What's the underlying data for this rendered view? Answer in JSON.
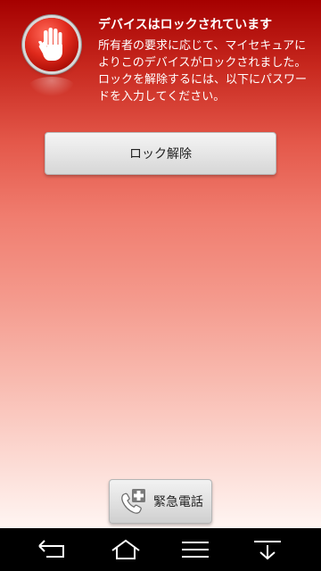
{
  "lock_screen": {
    "title": "デバイスはロックされています",
    "message": "所有者の要求に応じて、マイセキュアによりこのデバイスがロックされました。ロックを解除するには、以下にパスワードを入力してください。",
    "badge_icon": "stop-hand-icon",
    "unlock_label": "ロック解除",
    "emergency_label": "緊急電話",
    "emergency_icon": "emergency-phone-icon"
  },
  "navbar": {
    "items": [
      {
        "icon": "back-icon"
      },
      {
        "icon": "home-icon"
      },
      {
        "icon": "menu-icon"
      },
      {
        "icon": "notifications-pull-down-icon"
      }
    ]
  },
  "colors": {
    "gradient_top": "#a50000",
    "gradient_bottom": "#ffffff",
    "badge_red": "#e02a1c",
    "navbar": "#000000"
  }
}
